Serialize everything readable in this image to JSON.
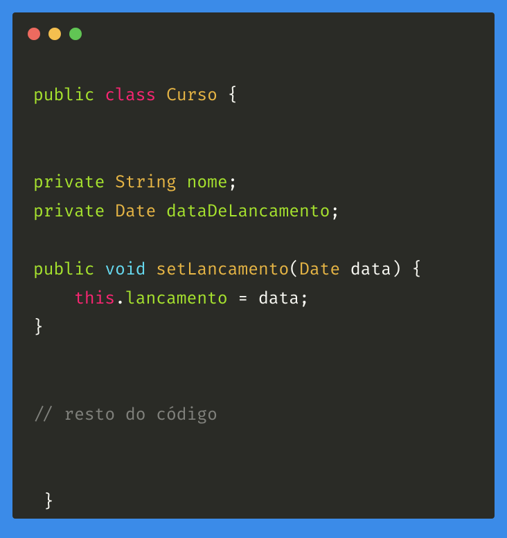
{
  "code": {
    "line1": {
      "public": "public",
      "class": "class",
      "classname": "Curso",
      "brace": " {"
    },
    "line2": {
      "private": "private",
      "type": "String",
      "name": "nome",
      "semi": ";"
    },
    "line3": {
      "private": "private",
      "type": "Date",
      "name": "dataDeLancamento",
      "semi": ";"
    },
    "line4": {
      "public": "public",
      "void": "void",
      "method": "setLancamento",
      "paren_open": "(",
      "param_type": "Date",
      "param_name": "data",
      "paren_close_brace": ") {"
    },
    "line5": {
      "indent": "    ",
      "this": "this",
      "dot": ".",
      "member": "lancamento",
      "eq": " = ",
      "value": "data",
      "semi": ";"
    },
    "line6": {
      "close_brace": "}"
    },
    "line7": {
      "comment": "// resto do código"
    },
    "line8": {
      "close_brace": " }"
    }
  }
}
